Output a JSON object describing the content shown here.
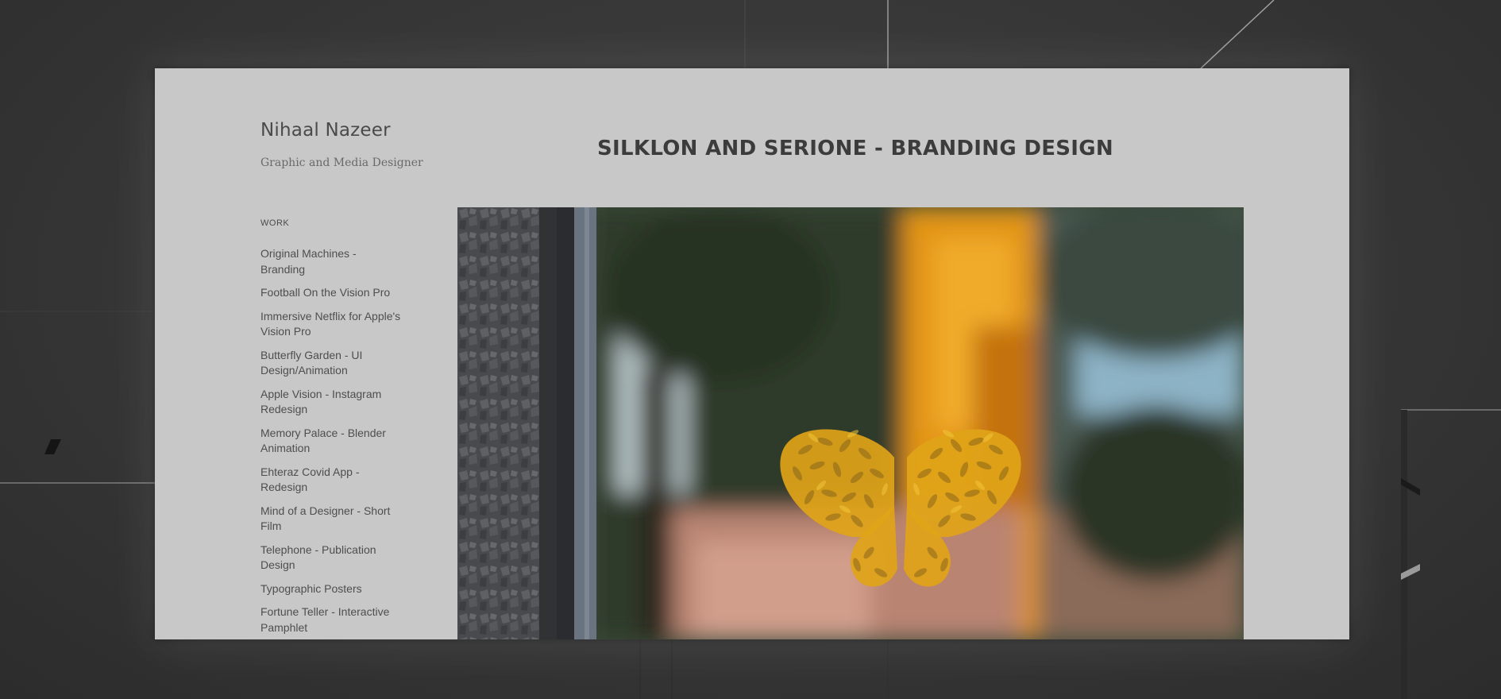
{
  "site": {
    "name": "Nihaal Nazeer",
    "tagline": "Graphic and Media Designer"
  },
  "nav": {
    "heading": "WORK",
    "items": [
      "Original Machines - Branding",
      "Football On the Vision Pro",
      "Immersive Netflix for Apple's Vision Pro",
      "Butterfly Garden - UI Design/Animation",
      "Apple Vision - Instagram Redesign",
      "Memory Palace - Blender Animation",
      "Ehteraz Covid App - Redesign",
      "Mind of a Designer - Short Film",
      "Telephone - Publication Design",
      "Typographic Posters",
      "Fortune Teller - Interactive Pamphlet"
    ]
  },
  "project": {
    "title": "SILKLON AND SERIONE - BRANDING DESIGN"
  },
  "icons": {
    "hero_motif": "butterfly-logo-icon"
  },
  "colors": {
    "window_bg": "#c8c8c8",
    "environment_bg": "#363636",
    "logo_gold": "#e0a418",
    "text_dark": "#3c3c3c"
  }
}
